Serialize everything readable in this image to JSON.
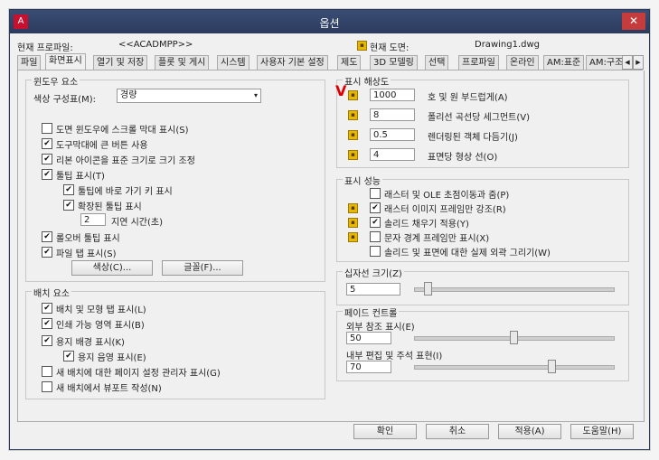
{
  "window": {
    "title": "옵션",
    "app_icon": "A",
    "close_glyph": "✕"
  },
  "info": {
    "profile_label": "현재 프로파일:",
    "profile_value": "<<ACADMPP>>",
    "drawing_label": "현재 도면:",
    "drawing_value": "Drawing1.dwg"
  },
  "tabs": [
    {
      "label": "파일"
    },
    {
      "label": "화면표시"
    },
    {
      "label": "열기 및 저장"
    },
    {
      "label": "플롯 및 게시"
    },
    {
      "label": "시스템"
    },
    {
      "label": "사용자 기본 설정"
    },
    {
      "label": "제도"
    },
    {
      "label": "3D 모델링"
    },
    {
      "label": "선택"
    },
    {
      "label": "프로파일"
    },
    {
      "label": "온라인"
    },
    {
      "label": "AM:표준"
    },
    {
      "label": "AM:구조"
    }
  ],
  "tab_scroll": {
    "left": "◀",
    "right": "▶"
  },
  "window_elements": {
    "title": "윈도우 요소",
    "color_scheme_label": "색상 구성표(M):",
    "color_scheme_value": "경량",
    "checkboxes": [
      {
        "label": "도면 윈도우에 스크롤 막대 표시(S)",
        "checked": false
      },
      {
        "label": "도구막대에 큰 버튼 사용",
        "checked": true
      },
      {
        "label": "리본 아이콘을 표준 크기로 크기 조정",
        "checked": true
      },
      {
        "label": "툴팁 표시(T)",
        "checked": true
      },
      {
        "label": "툴팁에 바로 가기 키 표시",
        "checked": true
      },
      {
        "label": "확장된 툴팁 표시",
        "checked": true
      },
      {
        "label": "롤오버 툴팁 표시",
        "checked": true
      },
      {
        "label": "파일 탭 표시(S)",
        "checked": true
      }
    ],
    "delay_value": "2",
    "delay_label": "지연 시간(초)",
    "colors_button": "색상(C)...",
    "fonts_button": "글꼴(F)..."
  },
  "layout_elements": {
    "title": "배치 요소",
    "checkboxes": [
      {
        "label": "배치 및 모형 탭 표시(L)",
        "checked": true
      },
      {
        "label": "인쇄 가능 영역 표시(B)",
        "checked": true
      },
      {
        "label": "용지 배경 표시(K)",
        "checked": true
      },
      {
        "label": "용지 음영 표시(E)",
        "checked": true
      },
      {
        "label": "새 배치에 대한 페이지 설정 관리자 표시(G)",
        "checked": false
      },
      {
        "label": "새 배치에서 뷰포트 작성(N)",
        "checked": false
      }
    ]
  },
  "resolution": {
    "title": "표시 해상도",
    "rows": [
      {
        "value": "1000",
        "label": "호 및 원 부드럽게(A)"
      },
      {
        "value": "8",
        "label": "폴리선 곡선당 세그먼트(V)"
      },
      {
        "value": "0.5",
        "label": "렌더링된 객체 다듬기(J)"
      },
      {
        "value": "4",
        "label": "표면당 형상 선(O)"
      }
    ]
  },
  "performance": {
    "title": "표시 성능",
    "checkboxes": [
      {
        "label": "래스터 및 OLE 초점이동과 줌(P)",
        "checked": false
      },
      {
        "label": "래스터 이미지 프레임만 강조(R)",
        "checked": true
      },
      {
        "label": "솔리드 채우기 적용(Y)",
        "checked": true
      },
      {
        "label": "문자 경계 프레임만 표시(X)",
        "checked": false
      },
      {
        "label": "솔리드 및 표면에 대한 실제 외곽 그리기(W)",
        "checked": false
      }
    ]
  },
  "crosshair": {
    "title": "십자선 크기(Z)",
    "value": "5",
    "level": 5
  },
  "fade": {
    "title": "페이드 컨트롤",
    "xref_label": "외부 참조 표시(E)",
    "xref_value": "50",
    "xref_level": 50,
    "inplace_label": "내부 편집 및 주석 표현(I)",
    "inplace_value": "70",
    "inplace_level": 70
  },
  "buttons": {
    "ok": "확인",
    "cancel": "취소",
    "apply": "적용(A)",
    "help": "도움말(H)"
  },
  "glyphs": {
    "check": "✔",
    "dropdown": "▾",
    "pin": "▪",
    "mark": "V"
  }
}
